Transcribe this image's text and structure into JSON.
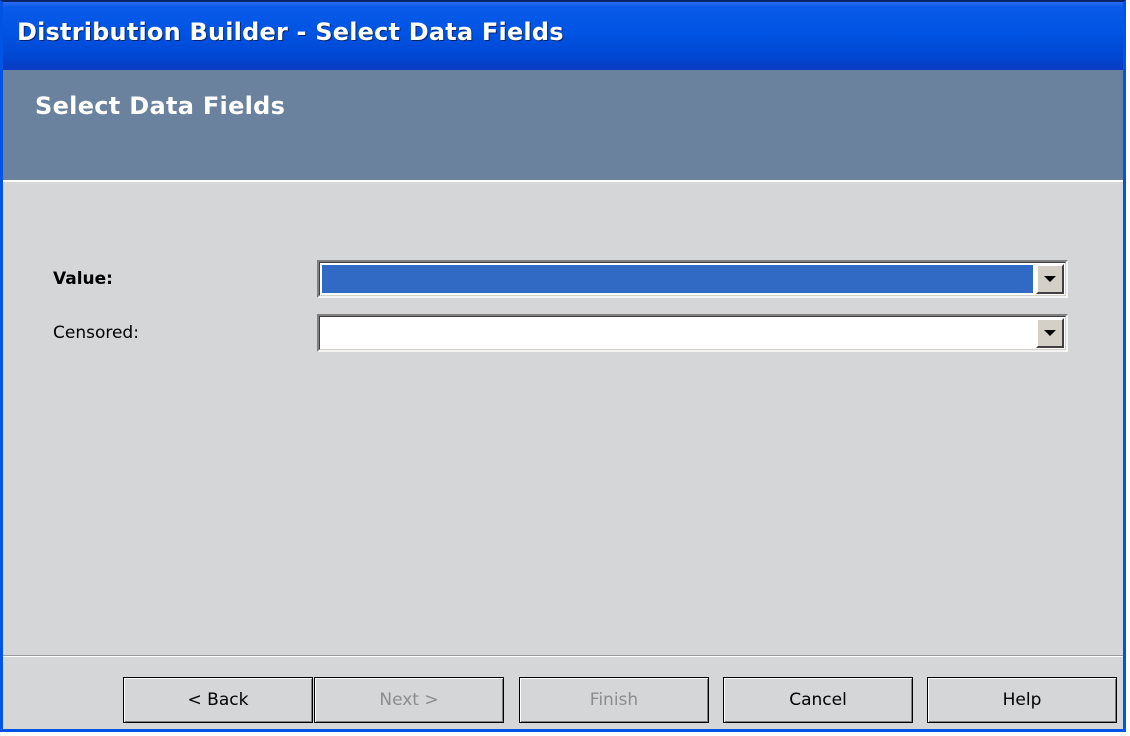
{
  "window": {
    "title": "Distribution Builder - Select Data Fields"
  },
  "header": {
    "heading": "Select Data Fields"
  },
  "form": {
    "fields": [
      {
        "label": "Value:",
        "value": "",
        "selected": true,
        "bold": true
      },
      {
        "label": "Censored:",
        "value": "",
        "selected": false,
        "bold": false
      }
    ]
  },
  "buttons": {
    "back": {
      "label": "< Back",
      "enabled": true
    },
    "next": {
      "label": "Next >",
      "enabled": false
    },
    "finish": {
      "label": "Finish",
      "enabled": false
    },
    "cancel": {
      "label": "Cancel",
      "enabled": true
    },
    "help": {
      "label": "Help",
      "enabled": true
    }
  },
  "icons": {
    "dropdown": "chevron-down-icon"
  },
  "colors": {
    "titlebar": "#0054e3",
    "header_band": "#6a829e",
    "selection": "#316ac5",
    "panel": "#d4d6d8"
  }
}
